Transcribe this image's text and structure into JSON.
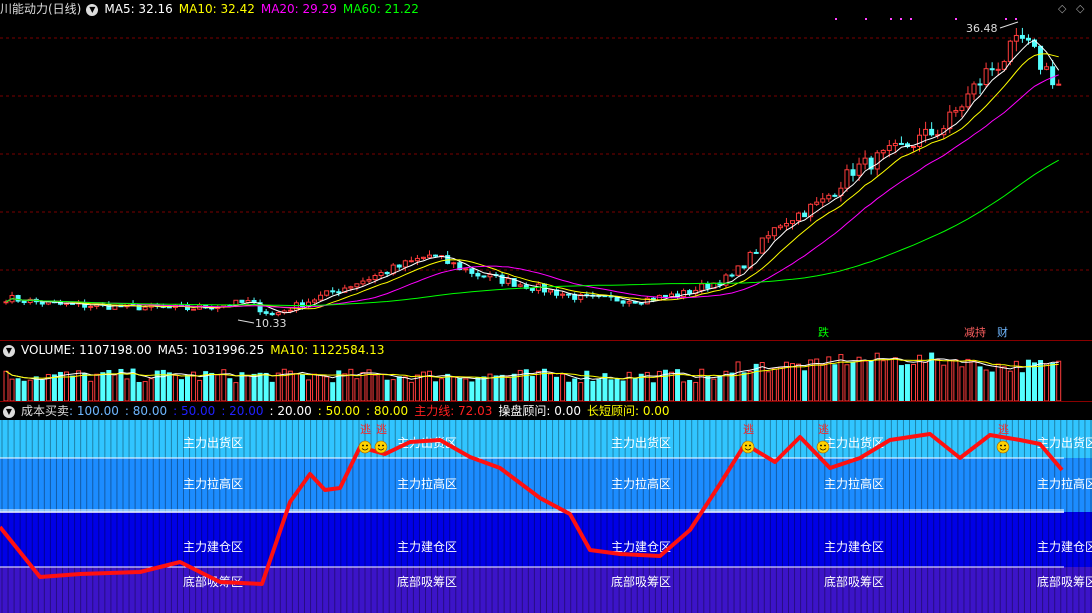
{
  "main": {
    "title": "川能动力(日线)",
    "ma_labels": [
      {
        "text": "MA5: 32.16",
        "color": "#ffffff"
      },
      {
        "text": "MA10: 32.42",
        "color": "#ffff00"
      },
      {
        "text": "MA20: 29.29",
        "color": "#ff00ff"
      },
      {
        "text": "MA60: 21.22",
        "color": "#00ff00"
      }
    ],
    "high_label": "36.48",
    "low_label": "10.33",
    "markers": [
      {
        "text": "跌",
        "color": "#00ff00"
      },
      {
        "text": "减持",
        "color": "#ff6060"
      },
      {
        "text": "财",
        "color": "#6fb7ff"
      }
    ],
    "corner_icons": [
      "diamond-icon",
      "diamond-icon"
    ]
  },
  "volume": {
    "labels": [
      {
        "text": "VOLUME: 1107198.00",
        "color": "#ffffff"
      },
      {
        "text": "MA5: 1031996.25",
        "color": "#ffffff"
      },
      {
        "text": "MA10: 1122584.13",
        "color": "#ffff00"
      }
    ]
  },
  "cost": {
    "title": "成本买卖",
    "labels": [
      {
        "text": ": 100.00",
        "color": "#6fb7ff"
      },
      {
        "text": ": 80.00",
        "color": "#6fb7ff"
      },
      {
        "text": ": 50.00",
        "color": "#2020ff"
      },
      {
        "text": ": 20.00",
        "color": "#2020ff"
      },
      {
        "text": ": 20.00",
        "color": "#ffffff"
      },
      {
        "text": ": 50.00",
        "color": "#ffff00"
      },
      {
        "text": ": 80.00",
        "color": "#ffff00"
      },
      {
        "text": "主力线: 72.03",
        "color": "#ff2020"
      },
      {
        "text": "操盘顾问: 0.00",
        "color": "#ffffff"
      },
      {
        "text": "长短顾问: 0.00",
        "color": "#ffff00"
      }
    ],
    "zones": [
      "主力出货区",
      "主力拉高区",
      "主力建仓区",
      "底部吸筹区"
    ],
    "escape_label": "逃"
  }
}
